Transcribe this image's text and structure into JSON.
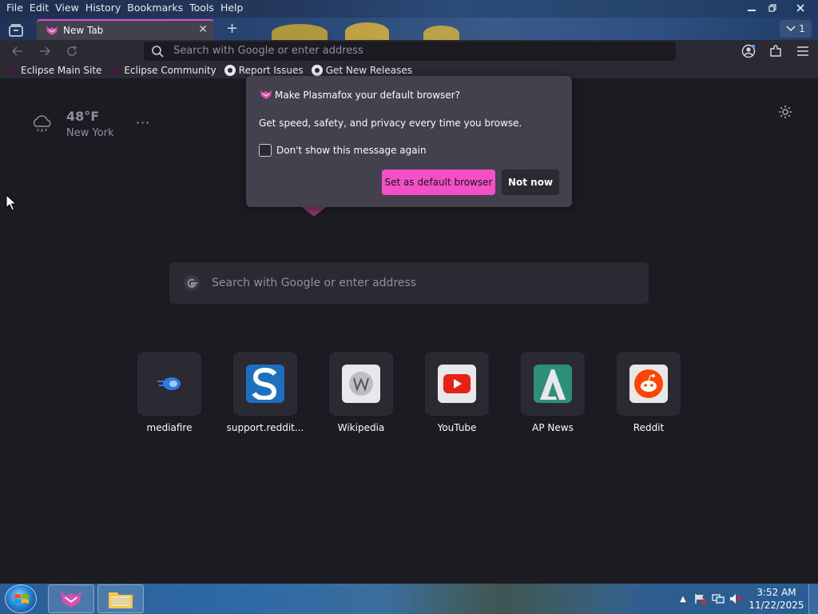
{
  "menu": [
    "File",
    "Edit",
    "View",
    "History",
    "Bookmarks",
    "Tools",
    "Help"
  ],
  "tab": {
    "title": "New Tab"
  },
  "tab_count": "1",
  "urlbar": {
    "placeholder": "Search with Google or enter address"
  },
  "bookmarks": [
    {
      "label": "Eclipse Main Site",
      "icon": "eclipse-icon"
    },
    {
      "label": "Eclipse Community",
      "icon": "eclipse-icon"
    },
    {
      "label": "Report Issues",
      "icon": "github-icon"
    },
    {
      "label": "Get New Releases",
      "icon": "github-icon"
    }
  ],
  "weather": {
    "temperature": "48°F",
    "city": "New York"
  },
  "popup": {
    "heading": "Make Plasmafox your default browser?",
    "body": "Get speed, safety, and privacy every time you browse.",
    "checkbox_label": "Don't show this message again",
    "primary_button": "Set as default browser",
    "secondary_button": "Not now"
  },
  "search": {
    "placeholder": "Search with Google or enter address"
  },
  "shortcuts": [
    {
      "label": "mediafire",
      "icon": "mediafire-icon"
    },
    {
      "label": "support.reddit...",
      "icon": "support-reddit-icon"
    },
    {
      "label": "Wikipedia",
      "icon": "wikipedia-icon"
    },
    {
      "label": "YouTube",
      "icon": "youtube-icon"
    },
    {
      "label": "AP News",
      "icon": "apnews-icon"
    },
    {
      "label": "Reddit",
      "icon": "reddit-icon"
    }
  ],
  "taskbar": {
    "time": "3:52 AM",
    "date": "11/22/2025"
  },
  "colors": {
    "accent": "#f34fc7",
    "tab_active_border": "#e04ad6",
    "background": "#1c1b22",
    "panel": "#42414d"
  }
}
